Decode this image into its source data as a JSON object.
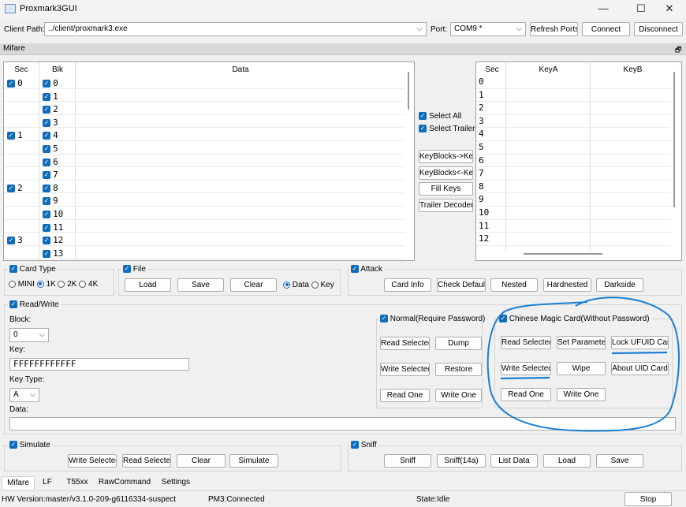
{
  "window": {
    "title": "Proxmark3GUI",
    "controls": {
      "minimize": "—",
      "maximize": "☐",
      "close": "✕"
    }
  },
  "toolbar": {
    "client_path_label": "Client Path:",
    "client_path_value": "../client/proxmark3.exe",
    "port_label": "Port:",
    "port_value": "COM9 *",
    "refresh_ports": "Refresh Ports",
    "connect": "Connect",
    "disconnect": "Disconnect"
  },
  "panel": {
    "title": "Mifare",
    "float_icon": "🗗"
  },
  "data_table": {
    "headers": [
      "Sec",
      "Blk",
      "Data"
    ],
    "rows": [
      {
        "sec": "0",
        "blk": "0"
      },
      {
        "sec": "",
        "blk": "1"
      },
      {
        "sec": "",
        "blk": "2"
      },
      {
        "sec": "",
        "blk": "3"
      },
      {
        "sec": "1",
        "blk": "4"
      },
      {
        "sec": "",
        "blk": "5"
      },
      {
        "sec": "",
        "blk": "6"
      },
      {
        "sec": "",
        "blk": "7"
      },
      {
        "sec": "2",
        "blk": "8"
      },
      {
        "sec": "",
        "blk": "9"
      },
      {
        "sec": "",
        "blk": "10"
      },
      {
        "sec": "",
        "blk": "11"
      },
      {
        "sec": "3",
        "blk": "12"
      },
      {
        "sec": "",
        "blk": "13"
      }
    ]
  },
  "middle": {
    "select_all": "Select All",
    "select_trailer": "Select Trailer",
    "keyblocks_to_key": "KeyBlocks->Key",
    "keyblocks_from_key": "KeyBlocks<-Key",
    "fill_keys": "Fill Keys",
    "trailer_decoder": "Trailer Decoder"
  },
  "key_table": {
    "headers": [
      "Sec",
      "KeyA",
      "KeyB"
    ],
    "rows": [
      "0",
      "1",
      "2",
      "3",
      "4",
      "5",
      "6",
      "7",
      "8",
      "9",
      "10",
      "11",
      "12"
    ]
  },
  "card_type": {
    "title": "Card Type",
    "options": [
      "MINI",
      "1K",
      "2K",
      "4K"
    ],
    "selected": "1K"
  },
  "file": {
    "title": "File",
    "load": "Load",
    "save": "Save",
    "clear": "Clear",
    "data_radio": "Data",
    "key_radio": "Key"
  },
  "attack": {
    "title": "Attack",
    "card_info": "Card Info",
    "check_default": "Check Default",
    "nested": "Nested",
    "hardnested": "Hardnested",
    "darkside": "Darkside"
  },
  "read_write": {
    "title": "Read/Write",
    "block_label": "Block:",
    "block_value": "0",
    "key_label": "Key:",
    "key_value": "FFFFFFFFFFFF",
    "key_type_label": "Key Type:",
    "key_type_value": "A",
    "data_label": "Data:",
    "data_value": ""
  },
  "normal": {
    "title": "Normal(Require Password)",
    "read_selected": "Read Selected",
    "dump": "Dump",
    "write_selected": "Write Selected",
    "restore": "Restore",
    "read_one": "Read One",
    "write_one": "Write One"
  },
  "magic": {
    "title": "Chinese Magic Card(Without Password)",
    "read_selected": "Read Selected",
    "set_parameter": "Set Parameter",
    "lock_ufuid": "Lock UFUID Card",
    "write_selected": "Write Selected",
    "wipe": "Wipe",
    "about_uid": "About UID Card",
    "read_one": "Read One",
    "write_one": "Write One"
  },
  "simulate": {
    "title": "Simulate",
    "write_selected": "Write Selected",
    "read_selected": "Read Selected",
    "clear": "Clear",
    "simulate": "Simulate"
  },
  "sniff": {
    "title": "Sniff",
    "sniff": "Sniff",
    "sniff14a": "Sniff(14a)",
    "list_data": "List Data",
    "load": "Load",
    "save": "Save"
  },
  "tabs": [
    "Mifare",
    "LF",
    "T55xx",
    "RawCommand",
    "Settings"
  ],
  "status": {
    "hw_version": "HW Version:master/v3.1.0-209-g6116334-suspect",
    "pm3": "PM3:Connected",
    "state": "State:Idle",
    "stop": "Stop"
  },
  "annotation_color": "#1a7fd4"
}
